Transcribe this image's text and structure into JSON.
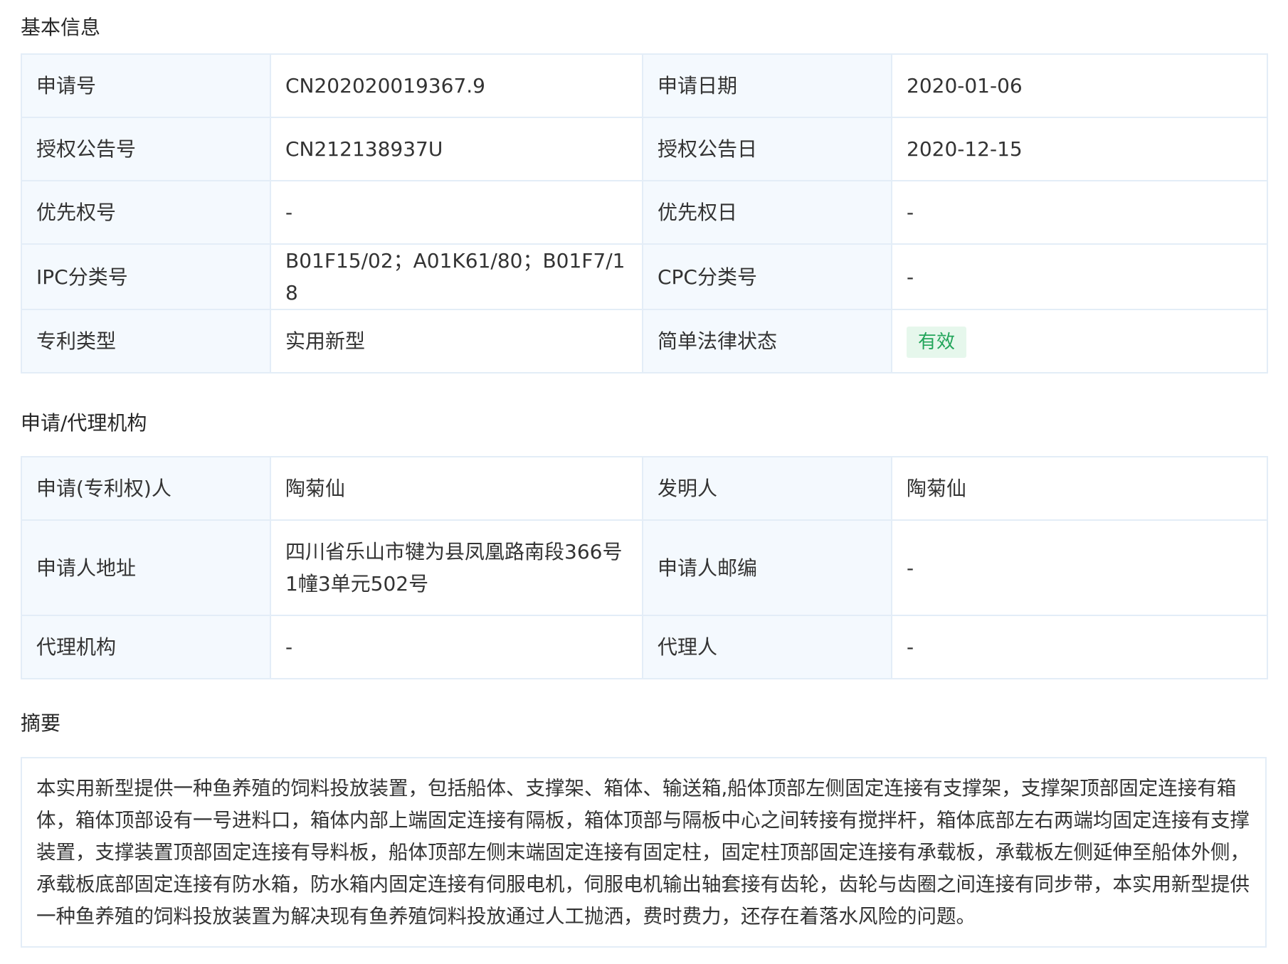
{
  "basic_info": {
    "title": "基本信息",
    "rows": [
      {
        "label1": "申请号",
        "value1": "CN202020019367.9",
        "label2": "申请日期",
        "value2": "2020-01-06"
      },
      {
        "label1": "授权公告号",
        "value1": "CN212138937U",
        "label2": "授权公告日",
        "value2": "2020-12-15"
      },
      {
        "label1": "优先权号",
        "value1": "-",
        "label2": "优先权日",
        "value2": "-"
      },
      {
        "label1": "IPC分类号",
        "value1": "B01F15/02；A01K61/80；B01F7/18",
        "label2": "CPC分类号",
        "value2": "-"
      },
      {
        "label1": "专利类型",
        "value1": "实用新型",
        "label2": "简单法律状态",
        "value2": "有效"
      }
    ]
  },
  "agency": {
    "title": "申请/代理机构",
    "rows": [
      {
        "label1": "申请(专利权)人",
        "value1": "陶菊仙",
        "label2": "发明人",
        "value2": "陶菊仙"
      },
      {
        "label1": "申请人地址",
        "value1": "四川省乐山市犍为县凤凰路南段366号1幢3单元502号",
        "label2": "申请人邮编",
        "value2": "-"
      },
      {
        "label1": "代理机构",
        "value1": "-",
        "label2": "代理人",
        "value2": "-"
      }
    ]
  },
  "abstract": {
    "title": "摘要",
    "text": "本实用新型提供一种鱼养殖的饲料投放装置，包括船体、支撑架、箱体、输送箱,船体顶部左侧固定连接有支撑架，支撑架顶部固定连接有箱体，箱体顶部设有一号进料口，箱体内部上端固定连接有隔板，箱体顶部与隔板中心之间转接有搅拌杆，箱体底部左右两端均固定连接有支撑装置，支撑装置顶部固定连接有导料板，船体顶部左侧末端固定连接有固定柱，固定柱顶部固定连接有承载板，承载板左侧延伸至船体外侧，承载板底部固定连接有防水箱，防水箱内固定连接有伺服电机，伺服电机输出轴套接有齿轮，齿轮与齿圈之间连接有同步带，本实用新型提供一种鱼养殖的饲料投放装置为解决现有鱼养殖饲料投放通过人工抛洒，费时费力，还存在着落水风险的问题。"
  },
  "colors": {
    "label_bg": "#f4f9fe",
    "border": "#e3edf7",
    "status_bg": "#e6f7ec",
    "status_text": "#22a55a"
  }
}
